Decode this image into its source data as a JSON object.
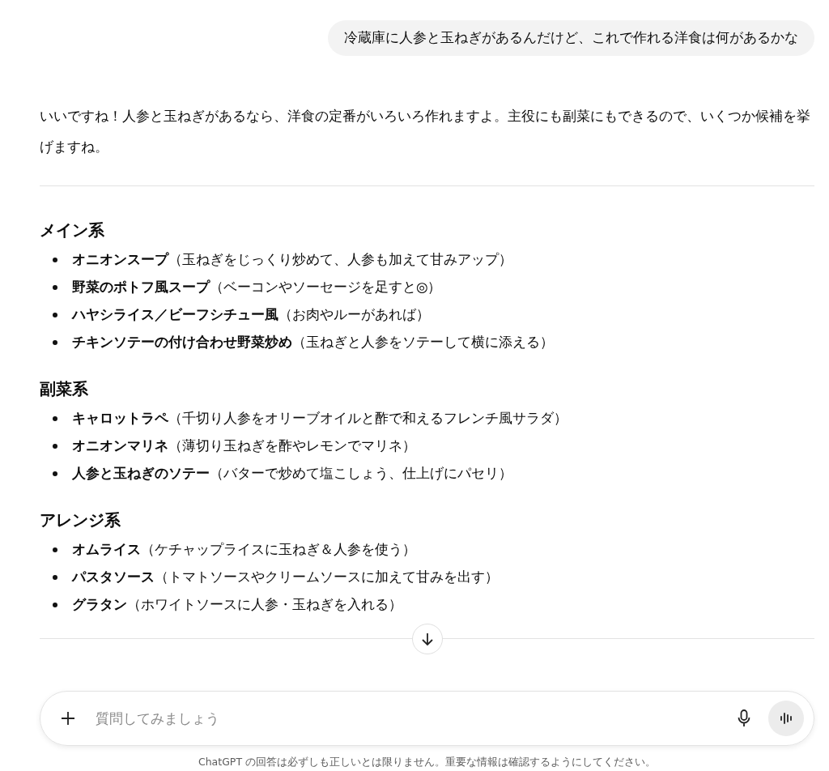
{
  "user_message": "冷蔵庫に人参と玉ねぎがあるんだけど、これで作れる洋食は何があるかな",
  "answer": {
    "intro": "いいですね！人参と玉ねぎがあるなら、洋食の定番がいろいろ作れますよ。主役にも副菜にもできるので、いくつか候補を挙げますね。",
    "sections": [
      {
        "heading": "メイン系",
        "items": [
          "**オニオンスープ**（玉ねぎをじっくり炒めて、人参も加えて甘みアップ）",
          "**野菜のポトフ風スープ**（ベーコンやソーセージを足すと◎）",
          "**ハヤシライス／ビーフシチュー風**（お肉やルーがあれば）",
          "**チキンソテーの付け合わせ野菜炒め**（玉ねぎと人参をソテーして横に添える）"
        ]
      },
      {
        "heading": "副菜系",
        "items": [
          "**キャロットラペ**（千切り人参をオリーブオイルと酢で和えるフレンチ風サラダ）",
          "**オニオンマリネ**（薄切り玉ねぎを酢やレモンでマリネ）",
          "**人参と玉ねぎのソテー**（バターで炒めて塩こしょう、仕上げにパセリ）"
        ]
      },
      {
        "heading": "アレンジ系",
        "items": [
          "**オムライス**（ケチャップライスに玉ねぎ＆人参を使う）",
          "**パスタソース**（トマトソースやクリームソースに加えて甘みを出す）",
          "**グラタン**（ホワイトソースに人参・玉ねぎを入れる）"
        ]
      }
    ]
  },
  "composer": {
    "placeholder": "質問してみましょう"
  },
  "disclaimer": "ChatGPT の回答は必ずしも正しいとは限りません。重要な情報は確認するようにしてください。"
}
